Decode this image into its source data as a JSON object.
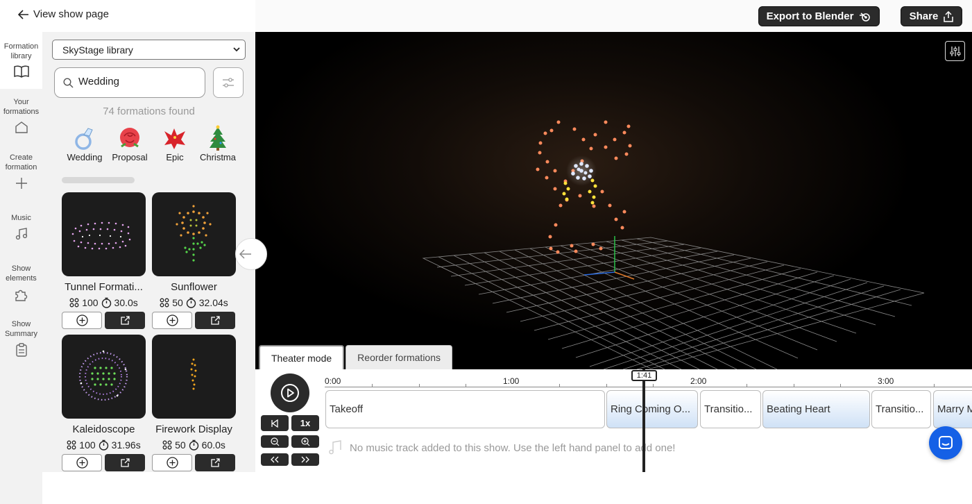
{
  "header": {
    "back_label": "View show page",
    "export_label": "Export to Blender",
    "share_label": "Share"
  },
  "nav": [
    {
      "label_line1": "Formation",
      "label_line2": "library",
      "icon": "book-icon"
    },
    {
      "label_line1": "Your",
      "label_line2": "formations",
      "icon": "home-icon"
    },
    {
      "label_line1": "Create",
      "label_line2": "formation",
      "icon": "plus-icon"
    },
    {
      "label_line1": "Music",
      "label_line2": "",
      "icon": "music-icon"
    },
    {
      "label_line1": "Show",
      "label_line2": "elements",
      "icon": "puzzle-icon"
    },
    {
      "label_line1": "Show",
      "label_line2": "Summary",
      "icon": "clipboard-icon"
    }
  ],
  "library": {
    "source_selected": "SkyStage library",
    "search_value": "Wedding",
    "found_text": "74 formations found",
    "categories": [
      {
        "label": "Wedding",
        "emoji": "💍"
      },
      {
        "label": "Proposal",
        "emoji": "🌹"
      },
      {
        "label": "Epic",
        "emoji": "🐉"
      },
      {
        "label": "Christma",
        "emoji": "🎄"
      }
    ],
    "cards": [
      {
        "title": "Tunnel Formati...",
        "drones": "100",
        "duration": "30.0s"
      },
      {
        "title": "Sunflower",
        "drones": "50",
        "duration": "32.04s"
      },
      {
        "title": "Kaleidoscope",
        "drones": "100",
        "duration": "31.96s"
      },
      {
        "title": "Firework Display",
        "drones": "50",
        "duration": "60.0s"
      }
    ]
  },
  "mode_tabs": {
    "theater": "Theater mode",
    "reorder": "Reorder formations"
  },
  "timeline": {
    "speed": "1x",
    "playhead_time": "1:41",
    "ruler_labels": [
      "0:00",
      "1:00",
      "2:00",
      "3:00"
    ],
    "blocks": [
      {
        "label": "Takeoff",
        "style": "plain"
      },
      {
        "label": "Ring Coming O...",
        "style": "blue"
      },
      {
        "label": "Transitio...",
        "style": "plain"
      },
      {
        "label": "Beating Heart",
        "style": "blue"
      },
      {
        "label": "Transitio...",
        "style": "plain"
      },
      {
        "label": "Marry M",
        "style": "blue"
      }
    ],
    "music_message": "No music track added to this show. Use the left hand panel to add one!"
  },
  "colors": {
    "dark_button": "#2b2b2b",
    "panel_bg": "#f2f2f2",
    "chat_blue": "#1560e6",
    "drone_orange": "#ff8a5c",
    "drone_yellow": "#ffe23a",
    "drone_white": "#dfe8ff"
  }
}
